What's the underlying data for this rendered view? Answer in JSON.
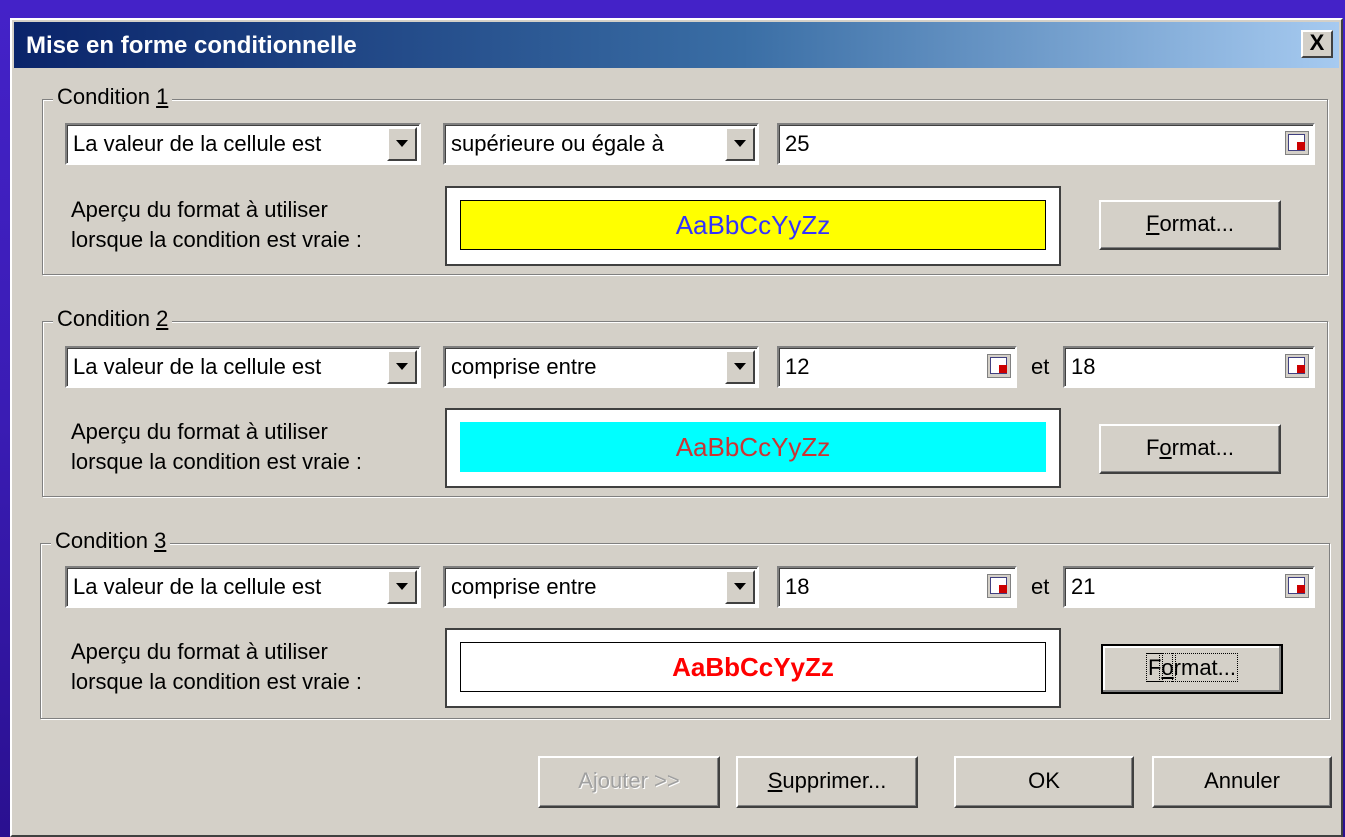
{
  "dialog": {
    "title": "Mise en forme conditionnelle",
    "close_label": "X"
  },
  "conditions": [
    {
      "label_prefix": "Condition ",
      "label_num": "1",
      "type": "La valeur de la cellule est",
      "operator": "supérieure ou égale à",
      "value1": "25",
      "preview_line1": "Aperçu du format à utiliser",
      "preview_line2": "lorsque la condition est vraie :",
      "preview_text": "AaBbCcYyZz",
      "preview_bg": "#ffff00",
      "preview_color": "#3333ff",
      "preview_bold": false,
      "format_accel": "F",
      "format_rest": "ormat..."
    },
    {
      "label_prefix": "Condition ",
      "label_num": "2",
      "type": "La valeur de la cellule est",
      "operator": "comprise entre",
      "value1": "12",
      "and_label": "et",
      "value2": "18",
      "preview_line1": "Aperçu du format à utiliser",
      "preview_line2": "lorsque la condition est vraie :",
      "preview_text": "AaBbCcYyZz",
      "preview_bg": "#00ffff",
      "preview_color": "#cc3333",
      "preview_bold": false,
      "format_pre": "F",
      "format_accel": "o",
      "format_rest": "rmat..."
    },
    {
      "label_prefix": "Condition ",
      "label_num": "3",
      "type": "La valeur de la cellule est",
      "operator": "comprise entre",
      "value1": "18",
      "and_label": "et",
      "value2": "21",
      "preview_line1": "Aperçu du format à utiliser",
      "preview_line2": "lorsque la condition est vraie :",
      "preview_text": "AaBbCcYyZz",
      "preview_bg": "#ffffff",
      "preview_color": "#ff0000",
      "preview_bold": true,
      "format_pre": "F",
      "format_accel": "o",
      "format_rest": "rmat..."
    }
  ],
  "buttons": {
    "add": "Ajouter >>",
    "delete_accel": "S",
    "delete_rest": "upprimer...",
    "ok": "OK",
    "cancel": "Annuler"
  }
}
